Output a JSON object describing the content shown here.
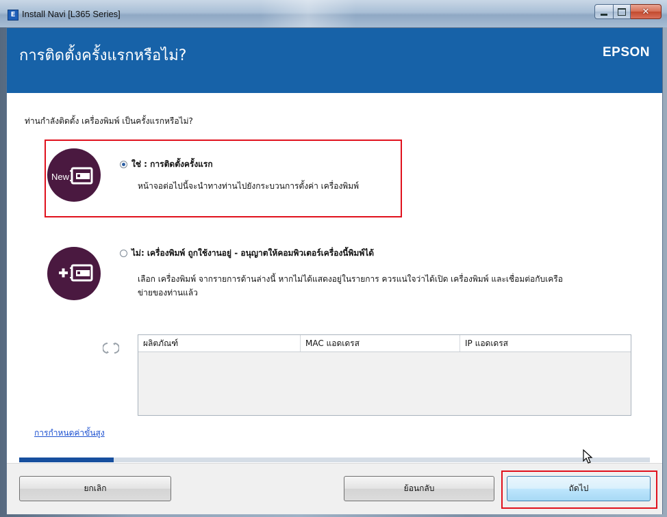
{
  "window": {
    "title": "Install Navi [L365 Series]",
    "icon_letter": "E",
    "caption_buttons": [
      "minimize-icon",
      "maximize-icon",
      "close-icon"
    ]
  },
  "header": {
    "title": "การติดตั้งครั้งแรกหรือไม่?",
    "brand": "EPSON",
    "color": "#1762a8"
  },
  "question": "ท่านกำลังติดตั้ง เครื่องพิมพ์ เป็นครั้งแรกหรือไม่?",
  "options": [
    {
      "icon_badge": "New",
      "selected": true,
      "label": "ใช่ : การติดตั้งครั้งแรก",
      "description": "หน้าจอต่อไปนี้จะนำทางท่านไปยังกระบวนการตั้งค่า เครื่องพิมพ์"
    },
    {
      "icon_badge": "+",
      "selected": false,
      "label": "ไม่: เครื่องพิมพ์ ถูกใช้งานอยู่ - อนุญาตให้คอมพิวเตอร์เครื่องนี้พิมพ์ได้",
      "description_line1": "เลือก เครื่องพิมพ์ จากรายการด้านล่างนี้  หากไม่ได้แสดงอยู่ในรายการ ควรแน่ใจว่าได้เปิด เครื่องพิมพ์ และเชื่อมต่อกับเครือ",
      "description_line2": "ข่ายของท่านแล้ว"
    }
  ],
  "printer_table": {
    "columns": [
      "ผลิตภัณฑ์",
      "MAC แอดเดรส",
      "IP แอดเดรส"
    ],
    "rows": []
  },
  "advanced_link": "การกำหนดค่าขั้นสูง",
  "progress": {
    "value": 0.15
  },
  "footer": {
    "cancel": "ยกเลิก",
    "back": "ย้อนกลับ",
    "next": "ถัดไป"
  },
  "highlight_color": "#e0101c"
}
